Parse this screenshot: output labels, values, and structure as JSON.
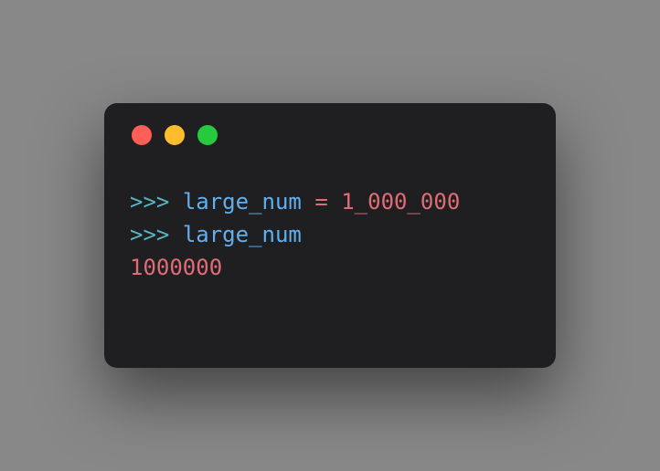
{
  "terminal": {
    "lines": [
      {
        "prompt": ">>>",
        "ident": "large_num",
        "op": "=",
        "number": "1_000_000"
      },
      {
        "prompt": ">>>",
        "ident": "large_num"
      },
      {
        "output": "1000000"
      }
    ]
  },
  "window": {
    "buttons": {
      "close": "close",
      "minimize": "minimize",
      "maximize": "maximize"
    }
  }
}
